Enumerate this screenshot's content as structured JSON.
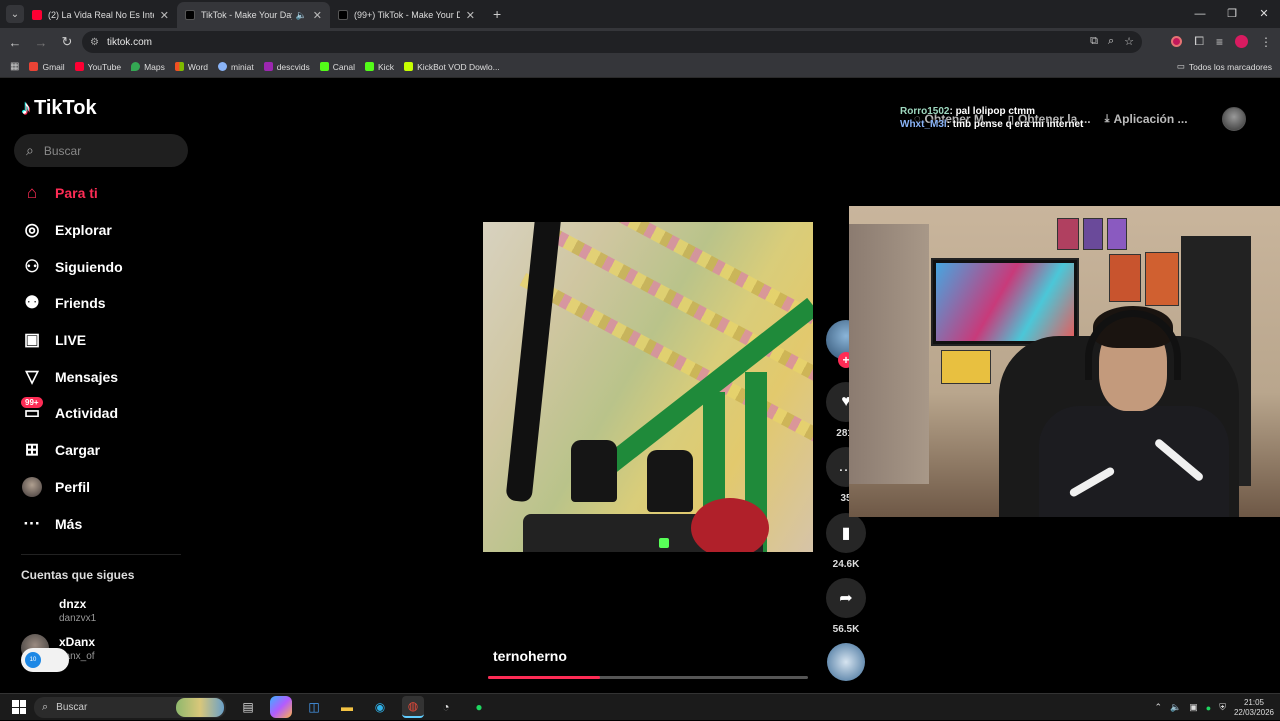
{
  "browser": {
    "tabs": [
      {
        "title": "(2) La Vida Real No Es Internet",
        "icon": "youtube-icon",
        "color": "#ff0033"
      },
      {
        "title": "TikTok - Make Your Day",
        "icon": "tiktok-icon",
        "color": "#ffffff"
      },
      {
        "title": "(99+) TikTok - Make Your Day",
        "icon": "tiktok-icon",
        "color": "#ffffff"
      }
    ],
    "url": "tiktok.com",
    "bookmarks": [
      {
        "label": "Gmail",
        "color": "#ea4335"
      },
      {
        "label": "YouTube",
        "color": "#ff0033"
      },
      {
        "label": "Maps",
        "color": "#34a853"
      },
      {
        "label": "Word",
        "color": "#2b7cd3"
      },
      {
        "label": "miniat",
        "color": "#8ab4f8"
      },
      {
        "label": "descvids",
        "color": "#9c27b0"
      },
      {
        "label": "Canal",
        "color": "#53fc18"
      },
      {
        "label": "Kick",
        "color": "#53fc18"
      },
      {
        "label": "KickBot VOD Dowlo...",
        "color": "#c6ff00"
      }
    ],
    "all_bookmarks": "Todos los marcadores"
  },
  "tiktok": {
    "logo": "TikTok",
    "search_placeholder": "Buscar",
    "nav": [
      {
        "label": "Para ti",
        "icon": "home-icon",
        "active": true
      },
      {
        "label": "Explorar",
        "icon": "compass-icon"
      },
      {
        "label": "Siguiendo",
        "icon": "user-follow-icon"
      },
      {
        "label": "Friends",
        "icon": "friends-icon"
      },
      {
        "label": "LIVE",
        "icon": "live-tv-icon"
      },
      {
        "label": "Mensajes",
        "icon": "send-icon"
      },
      {
        "label": "Actividad",
        "icon": "inbox-icon",
        "badge": "99+"
      },
      {
        "label": "Cargar",
        "icon": "upload-icon"
      },
      {
        "label": "Perfil",
        "icon": "avatar"
      },
      {
        "label": "Más",
        "icon": "more-icon"
      }
    ],
    "following_title": "Cuentas que sigues",
    "following": [
      {
        "name": "dnzx",
        "handle": "danzvx1"
      },
      {
        "name": "xDanx",
        "handle": "danx_of"
      }
    ],
    "top_buttons": [
      "Obtener M...",
      "Obtener la ...",
      "Aplicación ..."
    ],
    "video": {
      "username": "ternoherno",
      "progress": 0.35,
      "likes": "281.",
      "comments": "35",
      "saves": "24.6K",
      "shares": "56.5K"
    }
  },
  "stream_chat": [
    {
      "user": "Rorro1502",
      "message": ": pal lolipop ctmm"
    },
    {
      "user": "Whxt_M3l",
      "message": ": tmb pense q era mi internet"
    }
  ],
  "taskbar": {
    "search": "Buscar",
    "time": "21:05",
    "date": "22/03/2026"
  },
  "colors": {
    "accent": "#fe2c55",
    "browser_bg": "#35363a"
  }
}
